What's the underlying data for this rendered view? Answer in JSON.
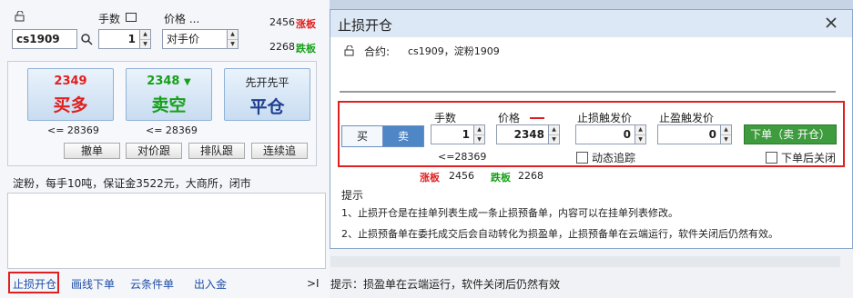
{
  "left": {
    "lock_icon": "lock-icon",
    "symbol": "cs1909",
    "qty_label": "手数",
    "qty_value": "1",
    "price_label": "价格 ...",
    "price_value": "对手价",
    "limit_up_price": "2456",
    "limit_up_label": "涨板",
    "limit_down_price": "2268",
    "limit_down_label": "跌板",
    "buy_price": "2349",
    "buy_label": "买多",
    "sell_price": "2348",
    "sell_label": "卖空",
    "close_header": "先开先平",
    "close_label": "平仓",
    "buy_max": "<= 28369",
    "sell_max": "<= 28369",
    "btn_cancel": "撤单",
    "btn_follow": "对价跟",
    "btn_queue": "排队跟",
    "btn_chase": "连续追",
    "info": "淀粉，每手10吨，保证金3522元，大商所，闭市",
    "tabs": [
      "止损开仓",
      "画线下单",
      "云条件单",
      "出入金"
    ]
  },
  "dialog": {
    "title": "止损开仓",
    "contract_label": "合约:",
    "contract_value": "cs1909，淀粉1909",
    "buy": "买",
    "sell": "卖",
    "qty_label": "手数",
    "qty_value": "1",
    "price_label": "价格",
    "price_value": "2348",
    "stop_loss_label": "止损触发价",
    "stop_loss_value": "0",
    "take_profit_label": "止盈触发价",
    "take_profit_value": "0",
    "order_button": "下单（卖 开仓）",
    "max_qty": "<=28369",
    "trailing_label": "动态追踪",
    "close_after_label": "下单后关闭",
    "limit_up_label": "涨板",
    "limit_up_price": "2456",
    "limit_down_label": "跌板",
    "limit_down_price": "2268",
    "tips_title": "提示",
    "tip1": "1、止损开仓是在挂单列表生成一条止损预备单，内容可以在挂单列表修改。",
    "tip2": "2、止损预备单在委托成交后会自动转化为损盈单，止损预备单在云端运行，软件关闭后仍然有效。"
  },
  "status": {
    "text": "提示：损盈单在云端运行，软件关闭后仍然有效",
    "arrow": ">I"
  },
  "colors": {
    "highlight": "#e02020",
    "order_green": "#3e9b3e",
    "sell_blue": "#4f86c6"
  }
}
